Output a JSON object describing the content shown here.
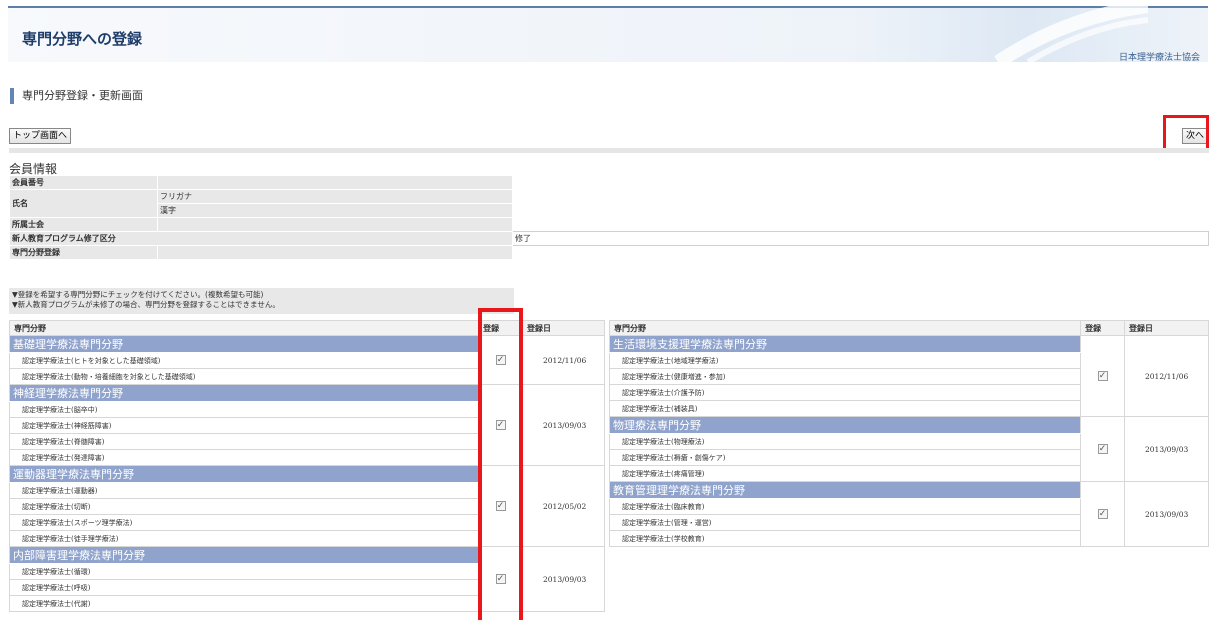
{
  "header": {
    "title": "専門分野への登録",
    "org": "日本理学療法士協会"
  },
  "section_heading": "専門分野登録・更新画面",
  "buttons": {
    "top": "トップ画面へ",
    "next": "次へ"
  },
  "member": {
    "title": "会員情報",
    "member_no_label": "会員番号",
    "name_label": "氏名",
    "furigana_label": "フリガナ",
    "kanji_label": "漢字",
    "branch_label": "所属士会",
    "program_label": "新人教育プログラム修了区分",
    "program_value": "修了",
    "specialty_label": "専門分野登録"
  },
  "notes": [
    "▼登録を希望する専門分野にチェックを付けてください。(複数希望も可能)",
    "▼新人教育プログラムが未修了の場合、専門分野を登録することはできません。"
  ],
  "table_headers": {
    "field": "専門分野",
    "register": "登録",
    "date": "登録日"
  },
  "left_categories": [
    {
      "name": "基礎理学療法専門分野",
      "date": "2012/11/06",
      "items": [
        "認定理学療法士(ヒトを対象とした基礎領域)",
        "認定理学療法士(動物・培養細胞を対象とした基礎領域)"
      ]
    },
    {
      "name": "神経理学療法専門分野",
      "date": "2013/09/03",
      "items": [
        "認定理学療法士(脳卒中)",
        "認定理学療法士(神経筋障害)",
        "認定理学療法士(脊髄障害)",
        "認定理学療法士(発達障害)"
      ]
    },
    {
      "name": "運動器理学療法専門分野",
      "date": "2012/05/02",
      "items": [
        "認定理学療法士(運動器)",
        "認定理学療法士(切断)",
        "認定理学療法士(スポーツ理学療法)",
        "認定理学療法士(徒手理学療法)"
      ]
    },
    {
      "name": "内部障害理学療法専門分野",
      "date": "2013/09/03",
      "items": [
        "認定理学療法士(循環)",
        "認定理学療法士(呼吸)",
        "認定理学療法士(代謝)"
      ]
    }
  ],
  "right_categories": [
    {
      "name": "生活環境支援理学療法専門分野",
      "date": "2012/11/06",
      "items": [
        "認定理学療法士(地域理学療法)",
        "認定理学療法士(健康増進・参加)",
        "認定理学療法士(介護予防)",
        "認定理学療法士(補装具)"
      ]
    },
    {
      "name": "物理療法専門分野",
      "date": "2013/09/03",
      "items": [
        "認定理学療法士(物理療法)",
        "認定理学療法士(褥瘡・創傷ケア)",
        "認定理学療法士(疼痛管理)"
      ]
    },
    {
      "name": "教育管理理学療法専門分野",
      "date": "2013/09/03",
      "items": [
        "認定理学療法士(臨床教育)",
        "認定理学療法士(管理・運営)",
        "認定理学療法士(学校教育)"
      ]
    }
  ],
  "checkmark": "✓",
  "colors": {
    "category_bg": "#8fa3cd",
    "highlight": "#e8171b",
    "header_border": "#5c7fa9"
  }
}
